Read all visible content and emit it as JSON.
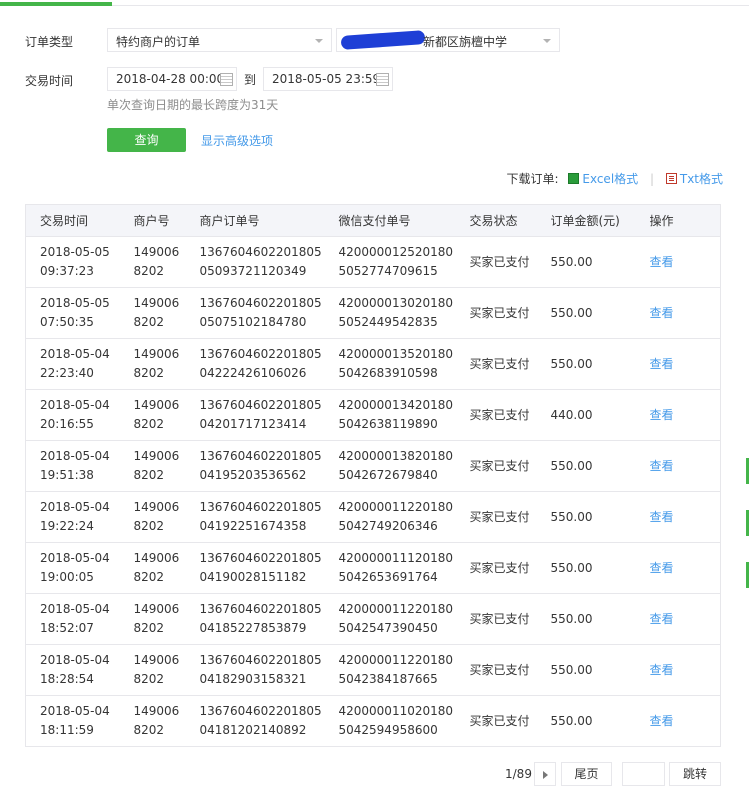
{
  "filters": {
    "order_type_label": "订单类型",
    "order_type_value": "特约商户的订单",
    "merchant_value": "新都区旃檀中学",
    "trade_time_label": "交易时间",
    "start_date": "2018-04-28 00:00:",
    "to_label": "到",
    "end_date": "2018-05-05 23:59:",
    "hint": "单次查询日期的最长跨度为31天",
    "query_button": "查询",
    "advanced_link": "显示高级选项"
  },
  "download": {
    "label": "下载订单:",
    "excel": "Excel格式",
    "txt": "Txt格式"
  },
  "table": {
    "headers": [
      "交易时间",
      "商户号",
      "商户订单号",
      "微信支付单号",
      "交易状态",
      "订单金额(元)",
      "操作"
    ],
    "rows": [
      {
        "time": "2018-05-05 09:37:23",
        "merchant_no": "1490068202",
        "order_no": "136760460220180505093721120349",
        "wx_no": "4200000125201805052774709615",
        "status": "买家已支付",
        "amount": "550.00",
        "action": "查看"
      },
      {
        "time": "2018-05-05 07:50:35",
        "merchant_no": "1490068202",
        "order_no": "136760460220180505075102184780",
        "wx_no": "4200000130201805052449542835",
        "status": "买家已支付",
        "amount": "550.00",
        "action": "查看"
      },
      {
        "time": "2018-05-04 22:23:40",
        "merchant_no": "1490068202",
        "order_no": "136760460220180504222426106026",
        "wx_no": "4200000135201805042683910598",
        "status": "买家已支付",
        "amount": "550.00",
        "action": "查看"
      },
      {
        "time": "2018-05-04 20:16:55",
        "merchant_no": "1490068202",
        "order_no": "136760460220180504201717123414",
        "wx_no": "4200000134201805042638119890",
        "status": "买家已支付",
        "amount": "440.00",
        "action": "查看"
      },
      {
        "time": "2018-05-04 19:51:38",
        "merchant_no": "1490068202",
        "order_no": "136760460220180504195203536562",
        "wx_no": "4200000138201805042672679840",
        "status": "买家已支付",
        "amount": "550.00",
        "action": "查看"
      },
      {
        "time": "2018-05-04 19:22:24",
        "merchant_no": "1490068202",
        "order_no": "136760460220180504192251674358",
        "wx_no": "4200000112201805042749206346",
        "status": "买家已支付",
        "amount": "550.00",
        "action": "查看"
      },
      {
        "time": "2018-05-04 19:00:05",
        "merchant_no": "1490068202",
        "order_no": "136760460220180504190028151182",
        "wx_no": "4200000111201805042653691764",
        "status": "买家已支付",
        "amount": "550.00",
        "action": "查看"
      },
      {
        "time": "2018-05-04 18:52:07",
        "merchant_no": "1490068202",
        "order_no": "136760460220180504185227853879",
        "wx_no": "4200000112201805042547390450",
        "status": "买家已支付",
        "amount": "550.00",
        "action": "查看"
      },
      {
        "time": "2018-05-04 18:28:54",
        "merchant_no": "1490068202",
        "order_no": "136760460220180504182903158321",
        "wx_no": "4200000112201805042384187665",
        "status": "买家已支付",
        "amount": "550.00",
        "action": "查看"
      },
      {
        "time": "2018-05-04 18:11:59",
        "merchant_no": "1490068202",
        "order_no": "136760460220180504181202140892",
        "wx_no": "4200000110201805042594958600",
        "status": "买家已支付",
        "amount": "550.00",
        "action": "查看"
      }
    ]
  },
  "pagination": {
    "page_info": "1/89",
    "last_page": "尾页",
    "jump_value": "",
    "jump": "跳转"
  }
}
